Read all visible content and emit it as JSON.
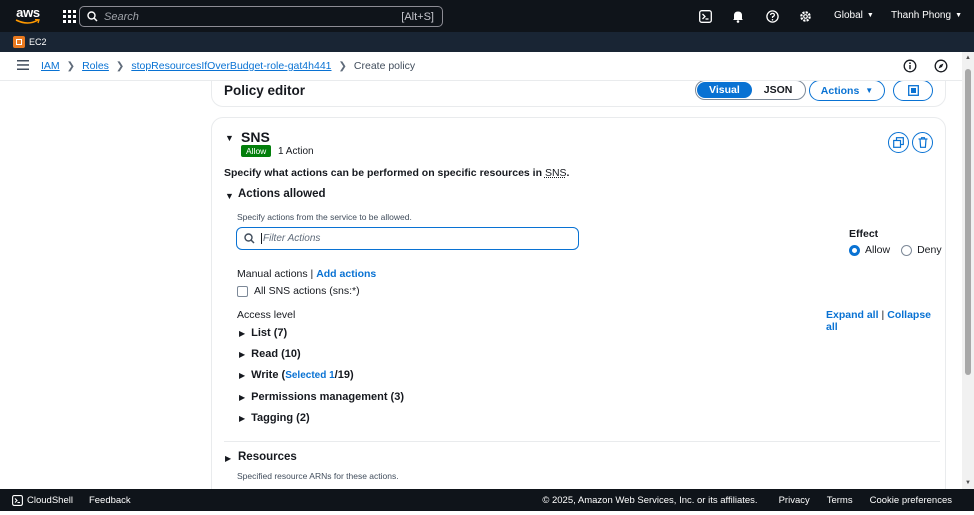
{
  "topnav": {
    "logo_text": "aws",
    "search_placeholder": "Search",
    "search_shortcut": "[Alt+S]",
    "region": "Global",
    "user": "Thanh Phong"
  },
  "servicebar": {
    "service": "EC2"
  },
  "breadcrumb": {
    "items": [
      {
        "label": "IAM"
      },
      {
        "label": "Roles"
      },
      {
        "label": "stopResourcesIfOverBudget-role-gat4h441"
      }
    ],
    "current": "Create policy"
  },
  "editor": {
    "title": "Policy editor",
    "tab_visual": "Visual",
    "tab_json": "JSON",
    "actions_label": "Actions"
  },
  "sns": {
    "title": "SNS",
    "badge": "Allow",
    "action_count": "1 Action",
    "specify_prefix": "Specify what actions can be performed on specific resources in ",
    "specify_service": "SNS",
    "specify_suffix": ".",
    "actions_allowed_title": "Actions allowed",
    "actions_allowed_desc": "Specify actions from the service to be allowed.",
    "filter_placeholder": "Filter Actions",
    "effect_label": "Effect",
    "effect_allow": "Allow",
    "effect_deny": "Deny",
    "manual_actions": "Manual actions",
    "manual_sep": " | ",
    "add_actions": "Add actions",
    "all_actions": "All SNS actions (sns:*)",
    "access_level": "Access level",
    "expand_all": "Expand all",
    "collapse_all": "Collapse all",
    "groups": {
      "list": "List (7)",
      "read": "Read (10)",
      "write_prefix": "Write (",
      "write_selected": "Selected 1",
      "write_suffix": "/19)",
      "permissions": "Permissions management (3)",
      "tagging": "Tagging (2)"
    },
    "resources_title": "Resources",
    "resources_desc": "Specified resource ARNs for these actions."
  },
  "footer": {
    "cloudshell": "CloudShell",
    "feedback": "Feedback",
    "copyright": "© 2025, Amazon Web Services, Inc. or its affiliates.",
    "privacy": "Privacy",
    "terms": "Terms",
    "cookies": "Cookie preferences"
  }
}
